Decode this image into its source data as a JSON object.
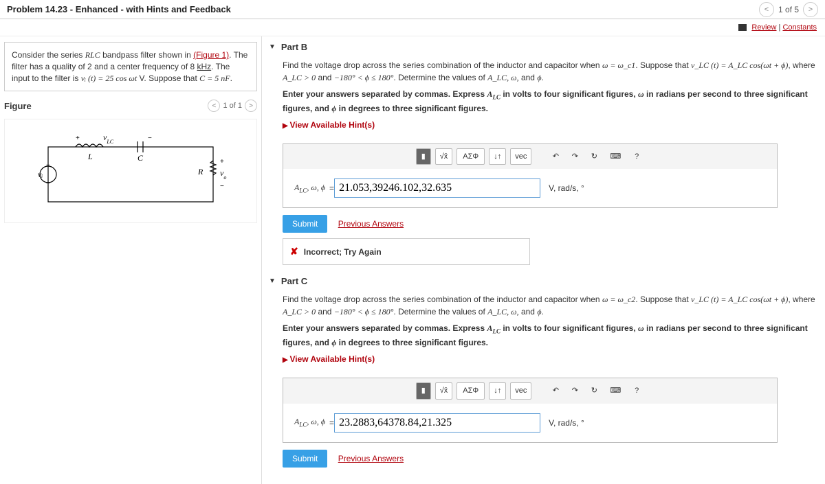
{
  "header": {
    "title": "Problem 14.23 - Enhanced - with Hints and Feedback",
    "progress": "1 of 5"
  },
  "review": {
    "review": "Review",
    "constants": "Constants"
  },
  "intro": {
    "line1a": "Consider the series ",
    "line1b": " bandpass filter shown in ",
    "figlink": "(Figure 1)",
    "line1c": ". The filter has a quality of 2 and a center frequency of 8 ",
    "khz": "kHz",
    "line1d": ". The input to the filter is ",
    "eq": "vᵢ (t) = 25 cos ωt",
    "unitV": " V",
    "line1e": ". Suppose that ",
    "cval": "C = 5 nF",
    "period": "."
  },
  "figure": {
    "title": "Figure",
    "page": "1 of 1"
  },
  "toolbar": {
    "sqrt": "√x̄",
    "sigma": "ΑΣΦ",
    "updown": "↓↑",
    "vec": "vec",
    "undo": "↶",
    "redo": "↷",
    "reset": "↻",
    "kbd": "⌨",
    "help": "?"
  },
  "common": {
    "equals": " = ",
    "answerLabel": "A_LC, ω, ϕ",
    "units": "V, rad/s, °",
    "submit": "Submit",
    "prev": "Previous Answers",
    "hints": "View Available Hint(s)"
  },
  "partB": {
    "label": "Part B",
    "promptA": "Find the voltage drop across the series combination of the inductor and capacitor when ",
    "eq1": "ω = ω_c1",
    "promptB": ". Suppose that ",
    "eq2": "v_LC (t) = A_LC cos(ωt + ϕ)",
    "promptC": ", where ",
    "eq3": "A_LC > 0",
    "and": " and ",
    "eq4": "−180° < ϕ ≤ 180°",
    "promptD": ". Determine the values of ",
    "eq5": "A_LC, ω,",
    "eq6": " ϕ",
    "instructA": "Enter your answers separated by commas. Express ",
    "instructB": " in volts to four significant figures, ",
    "instructC": " in radians per second to three significant figures, and ",
    "instructD": " in degrees to three significant figures.",
    "value": "21.053,39246.102,32.635",
    "feedback": "Incorrect; Try Again"
  },
  "partC": {
    "label": "Part C",
    "eq1": "ω = ω_c2",
    "value": "23.2883,64378.84,21.325"
  }
}
